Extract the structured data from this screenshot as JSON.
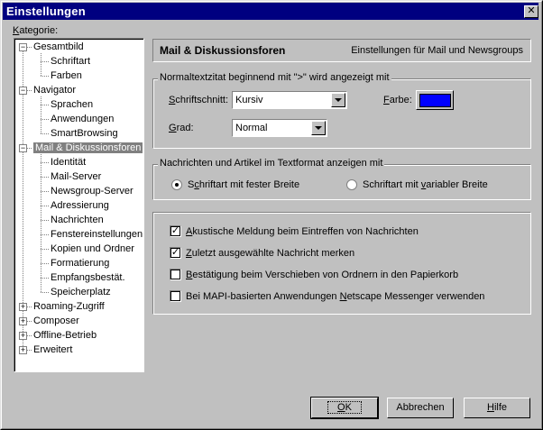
{
  "window": {
    "title": "Einstellungen",
    "close_glyph": "✕"
  },
  "kategorie_label": {
    "pre": "",
    "u": "K",
    "post": "ategorie:"
  },
  "tree": [
    {
      "label": "Gesamtbild",
      "level": 0,
      "expander": "−"
    },
    {
      "label": "Schriftart",
      "level": 1
    },
    {
      "label": "Farben",
      "level": 1
    },
    {
      "label": "Navigator",
      "level": 0,
      "expander": "−"
    },
    {
      "label": "Sprachen",
      "level": 1
    },
    {
      "label": "Anwendungen",
      "level": 1
    },
    {
      "label": "SmartBrowsing",
      "level": 1
    },
    {
      "label": "Mail & Diskussionsforen",
      "level": 0,
      "expander": "−",
      "selected": true
    },
    {
      "label": "Identität",
      "level": 1
    },
    {
      "label": "Mail-Server",
      "level": 1
    },
    {
      "label": "Newsgroup-Server",
      "level": 1
    },
    {
      "label": "Adressierung",
      "level": 1
    },
    {
      "label": "Nachrichten",
      "level": 1
    },
    {
      "label": "Fenstereinstellungen",
      "level": 1
    },
    {
      "label": "Kopien und Ordner",
      "level": 1
    },
    {
      "label": "Formatierung",
      "level": 1
    },
    {
      "label": "Empfangsbestät.",
      "level": 1
    },
    {
      "label": "Speicherplatz",
      "level": 1
    },
    {
      "label": "Roaming-Zugriff",
      "level": 0,
      "expander": "+"
    },
    {
      "label": "Composer",
      "level": 0,
      "expander": "+"
    },
    {
      "label": "Offline-Betrieb",
      "level": 0,
      "expander": "+"
    },
    {
      "label": "Erweitert",
      "level": 0,
      "expander": "+"
    }
  ],
  "header": {
    "title": "Mail & Diskussionsforen",
    "subtitle": "Einstellungen für Mail und Newsgroups"
  },
  "quote_group": {
    "label": "Normaltextzitat beginnend mit \">\" wird angezeigt mit",
    "style_label": {
      "pre": "",
      "u": "S",
      "post": "chriftschnitt:"
    },
    "style_value": "Kursiv",
    "size_label": {
      "pre": "",
      "u": "G",
      "post": "rad:"
    },
    "size_value": "Normal",
    "color_label": {
      "pre": "",
      "u": "F",
      "post": "arbe:"
    },
    "color_value": "#0000ff"
  },
  "plain_group": {
    "label": "Nachrichten und Artikel im Textformat anzeigen mit",
    "option_fixed": {
      "pre": "S",
      "u": "c",
      "post": "hriftart mit fester Breite",
      "selected": true
    },
    "option_variable": {
      "pre": "Schriftart mit ",
      "u": "v",
      "post": "ariabler Breite",
      "selected": false
    }
  },
  "checkboxes": [
    {
      "pre": "",
      "u": "A",
      "post": "kustische Meldung beim Eintreffen von Nachrichten",
      "checked": true
    },
    {
      "pre": "",
      "u": "Z",
      "post": "uletzt ausgewählte Nachricht merken",
      "checked": true
    },
    {
      "pre": "",
      "u": "B",
      "post": "estätigung beim Verschieben von Ordnern in den Papierkorb",
      "checked": false
    },
    {
      "pre": "Bei MAPI-basierten Anwendungen ",
      "u": "N",
      "post": "etscape Messenger verwenden",
      "checked": false
    }
  ],
  "buttons": {
    "ok": {
      "pre": "",
      "u": "O",
      "post": "K"
    },
    "cancel": "Abbrechen",
    "help": {
      "pre": "",
      "u": "H",
      "post": "ilfe"
    }
  }
}
